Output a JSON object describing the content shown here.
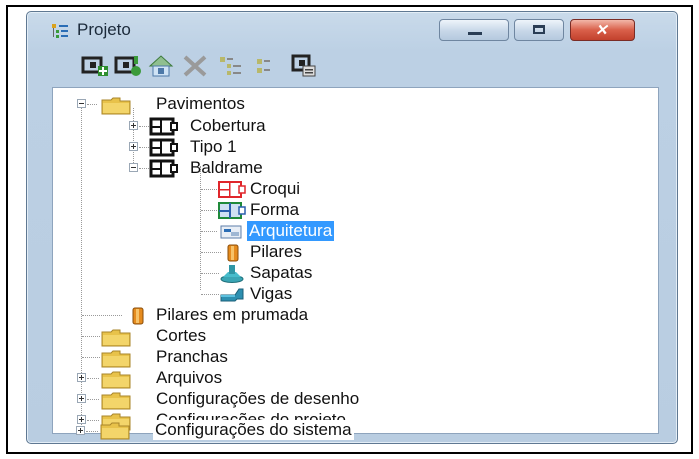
{
  "window": {
    "title": "Projeto",
    "close_glyph": "✕"
  },
  "toolbar": {
    "buttons": [
      {
        "name": "new-floor-icon"
      },
      {
        "name": "edit-floor-icon"
      },
      {
        "name": "export-icon"
      },
      {
        "name": "delete-icon"
      },
      {
        "name": "expand-tree-icon"
      },
      {
        "name": "collapse-tree-icon"
      },
      {
        "name": "properties-icon"
      }
    ]
  },
  "tree": {
    "pavimentos": "Pavimentos",
    "cobertura": "Cobertura",
    "tipo1": "Tipo 1",
    "baldrame": "Baldrame",
    "croqui": "Croqui",
    "forma": "Forma",
    "arquitetura": "Arquitetura",
    "pilares": "Pilares",
    "sapatas": "Sapatas",
    "vigas": "Vigas",
    "pilares_prumada": "Pilares em prumada",
    "cortes": "Cortes",
    "pranchas": "Pranchas",
    "arquivos": "Arquivos",
    "config_desenho": "Configurações de desenho",
    "config_projeto": "Configurações do projeto",
    "config_sistema": "Configurações do sistema",
    "selected": "Arquitetura"
  },
  "colors": {
    "selection": "#3399ff",
    "folder": "#e8c24a",
    "croqui": "#e0262b",
    "forma": "#1f8a3a"
  }
}
